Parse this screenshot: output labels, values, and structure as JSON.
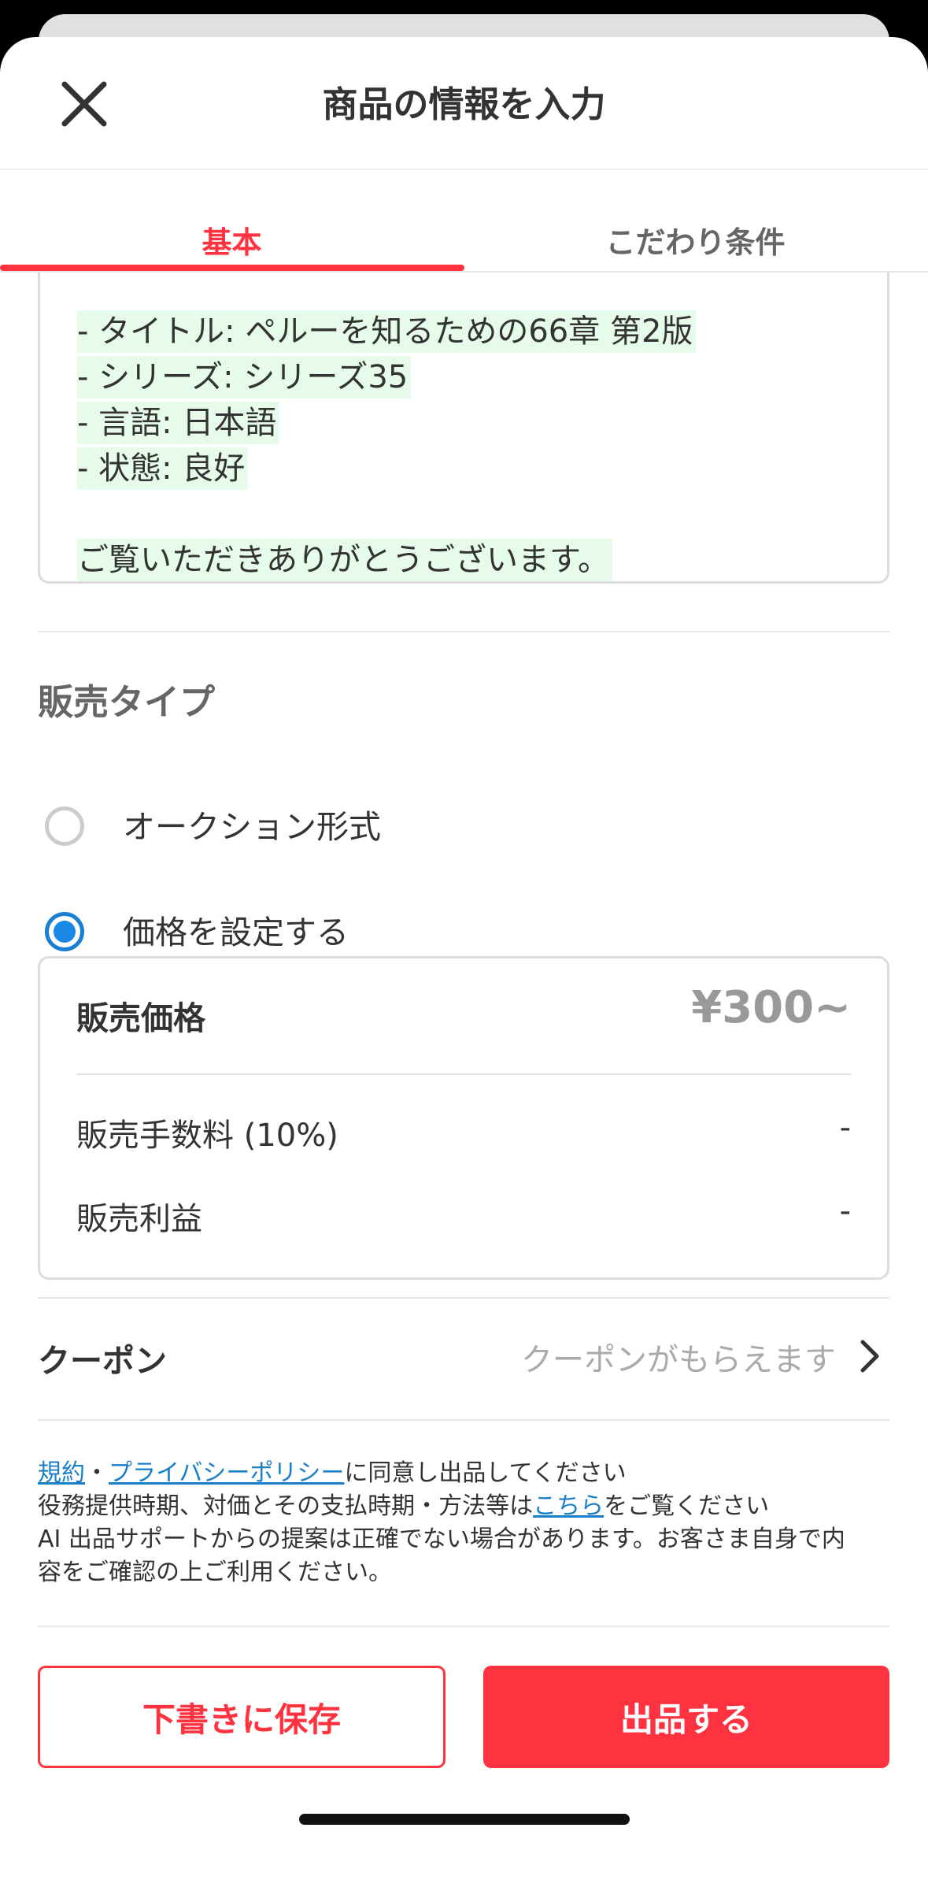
{
  "header": {
    "title": "商品の情報を入力",
    "close_icon": "close-icon"
  },
  "tabs": [
    {
      "label": "基本",
      "active": true
    },
    {
      "label": "こだわり条件",
      "active": false
    }
  ],
  "description": {
    "lines": [
      "- タイトル: ペルーを知るための66章 第2版",
      "- シリーズ: シリーズ35",
      "- 言語: 日本語",
      "- 状態: 良好",
      "ご覧いただきありがとうございます。"
    ]
  },
  "sale_type": {
    "title": "販売タイプ",
    "options": [
      {
        "label": "オークション形式",
        "selected": false
      },
      {
        "label": "価格を設定する",
        "selected": true
      }
    ]
  },
  "pricing": {
    "price_label": "販売価格",
    "price_value": "¥300~",
    "fee_label": "販売手数料 (10%)",
    "fee_value": "-",
    "profit_label": "販売利益",
    "profit_value": "-"
  },
  "coupon": {
    "label": "クーポン",
    "hint": "クーポンがもらえます",
    "chevron_icon": "chevron-right-icon"
  },
  "legal": {
    "link_terms": "規約",
    "separator": "・",
    "link_privacy": "プライバシーポリシー",
    "line1_rest": "に同意し出品してください",
    "line2_pre": "役務提供時期、対価とその支払時期・方法等は",
    "link_here": "こちら",
    "line2_post": "をご覧ください",
    "line3": "AI 出品サポートからの提案は正確でない場合があります。お客さま自身で内",
    "line4": "容をご確認の上ご利用ください。"
  },
  "buttons": {
    "draft": "下書きに保存",
    "submit": "出品する"
  },
  "colors": {
    "accent": "#ff333f",
    "radio_selected": "#1a89e6",
    "link": "#1a7fc7",
    "highlight": "#e6fbe9"
  }
}
